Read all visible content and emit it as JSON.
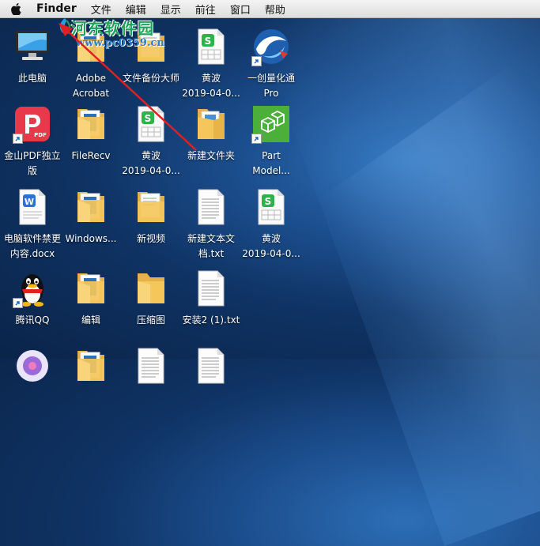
{
  "menubar": {
    "items": [
      {
        "label": "Finder",
        "bold": true
      },
      {
        "label": "文件"
      },
      {
        "label": "编辑"
      },
      {
        "label": "显示"
      },
      {
        "label": "前往"
      },
      {
        "label": "窗口"
      },
      {
        "label": "帮助"
      }
    ]
  },
  "watermark": {
    "title": "河东软件园",
    "url": "www.pc0359.cn"
  },
  "colors": {
    "annotation_arrow": "#e02020",
    "watermark_green": "#1fa35a",
    "wps_green": "#2fb24a",
    "folder_yellow": "#f5c65a"
  },
  "desktop": {
    "icons": [
      {
        "name": "this-pc",
        "icon": "computer-icon",
        "label": "此电脑"
      },
      {
        "name": "adobe-acrobat",
        "icon": "folder-icon",
        "label": "Adobe\nAcrobat"
      },
      {
        "name": "file-backup-master",
        "icon": "folder-docs-icon",
        "label": "文件备份大师"
      },
      {
        "name": "huangbo-sheet-1",
        "icon": "wps-sheet-icon",
        "label": "黄波\n2019-04-0..."
      },
      {
        "name": "yichuang-pro",
        "icon": "app-swirl-icon",
        "label": "一创量化通\nPro"
      },
      {
        "name": "kingsoft-pdf",
        "icon": "pdf-app-icon",
        "label": "金山PDF独立\n版"
      },
      {
        "name": "filerecv",
        "icon": "folder-icon",
        "label": "FileRecv"
      },
      {
        "name": "huangbo-sheet-2",
        "icon": "wps-sheet-icon",
        "label": "黄波\n2019-04-0..."
      },
      {
        "name": "new-folder",
        "icon": "folder-open-icon",
        "label": "新建文件夹"
      },
      {
        "name": "part-modeler",
        "icon": "cube-app-icon",
        "label": "Part\nModel..."
      },
      {
        "name": "computer-software-doc",
        "icon": "word-doc-icon",
        "label": "电脑软件禁更\n内容.docx"
      },
      {
        "name": "windows-folder",
        "icon": "folder-icon",
        "label": "Windows..."
      },
      {
        "name": "new-video",
        "icon": "folder-docs-icon",
        "label": "新视频"
      },
      {
        "name": "new-text-doc",
        "icon": "text-doc-icon",
        "label": "新建文本文\n档.txt"
      },
      {
        "name": "huangbo-sheet-3",
        "icon": "wps-sheet-icon",
        "label": "黄波\n2019-04-0..."
      },
      {
        "name": "tencent-qq",
        "icon": "qq-penguin-icon",
        "label": "腾讯QQ"
      },
      {
        "name": "edit-folder",
        "icon": "folder-icon",
        "label": "编辑"
      },
      {
        "name": "compressed-image",
        "icon": "folder-plain-icon",
        "label": "压缩图"
      },
      {
        "name": "install2-txt",
        "icon": "text-doc-icon",
        "label": "安装2 (1).txt"
      },
      {
        "name": "partial-app",
        "icon": "app-round-icon",
        "label": ""
      },
      {
        "name": "partial-folder",
        "icon": "folder-icon",
        "label": ""
      },
      {
        "name": "partial-doc-1",
        "icon": "text-doc-icon",
        "label": ""
      },
      {
        "name": "partial-doc-2",
        "icon": "text-doc-icon",
        "label": ""
      }
    ]
  }
}
